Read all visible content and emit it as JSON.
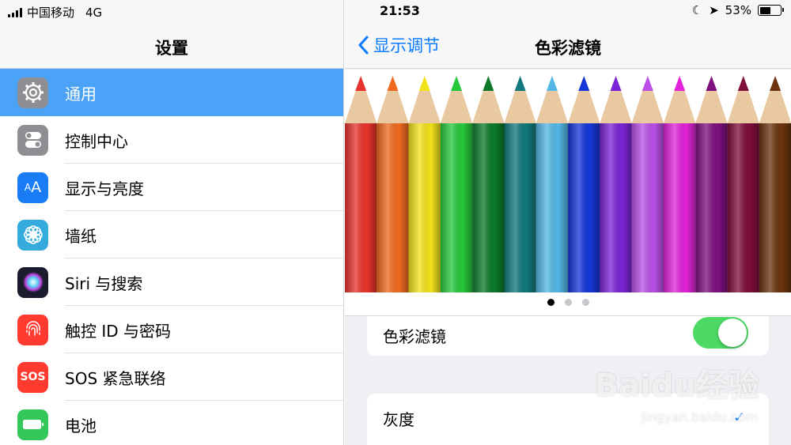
{
  "status_bar": {
    "carrier": "中国移动",
    "network": "4G",
    "time": "21:53",
    "battery_percent": "53%"
  },
  "sidebar": {
    "title": "设置",
    "items": [
      {
        "label": "通用",
        "icon": "gear-icon",
        "color": "#8e8e93",
        "selected": true
      },
      {
        "label": "控制中心",
        "icon": "control-center-icon",
        "color": "#8e8e93"
      },
      {
        "label": "显示与亮度",
        "icon": "display-brightness-icon",
        "color": "#1a7cf5"
      },
      {
        "label": "墙纸",
        "icon": "wallpaper-flower-icon",
        "color": "#35aadc"
      },
      {
        "label": "Siri 与搜索",
        "icon": "siri-icon",
        "color": "#222"
      },
      {
        "label": "触控 ID 与密码",
        "icon": "fingerprint-icon",
        "color": "#ff3b30"
      },
      {
        "label": "SOS 紧急联络",
        "icon": "sos-icon",
        "color": "#ff3b30",
        "icon_text": "SOS"
      },
      {
        "label": "电池",
        "icon": "battery-icon",
        "color": "#34c759"
      }
    ]
  },
  "detail": {
    "back_label": "显示调节",
    "title": "色彩滤镜",
    "page_dots": 3,
    "active_dot": 0,
    "toggle_label": "色彩滤镜",
    "toggle_on": true,
    "option_label": "灰度",
    "option_checked": true,
    "pencil_colors": [
      "#e8332c",
      "#ee6a1f",
      "#f2e21a",
      "#27c83c",
      "#0c7a2a",
      "#11787b",
      "#53b7e6",
      "#1436d8",
      "#7a24d6",
      "#b94fe6",
      "#e223d9",
      "#7d0f7e",
      "#7e0e3a",
      "#6b340f"
    ]
  },
  "watermark": {
    "brand": "Baidu经验",
    "url": "jingyan.baidu.com"
  },
  "colors": {
    "accent": "#0a7aff",
    "selection": "#4aa3f6",
    "switch_on": "#4cd964"
  }
}
